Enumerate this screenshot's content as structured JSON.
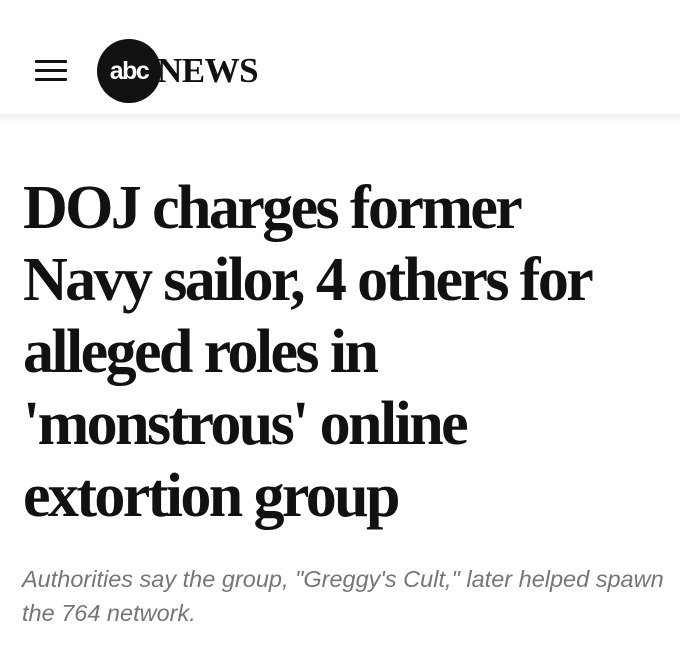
{
  "header": {
    "logo": {
      "circle_text": "abc",
      "wordmark": "NEWS"
    },
    "menu_icon": "hamburger-menu-icon"
  },
  "article": {
    "headline": "DOJ charges former Navy sailor, 4 others for alleged roles in 'monstrous' online extortion group",
    "dek": "Authorities say the group, \"Greggy's Cult,\" later helped spawn the 764 network."
  },
  "colors": {
    "text": "#111111",
    "dek": "#767676",
    "logo_circle": "#111111",
    "background": "#ffffff"
  }
}
